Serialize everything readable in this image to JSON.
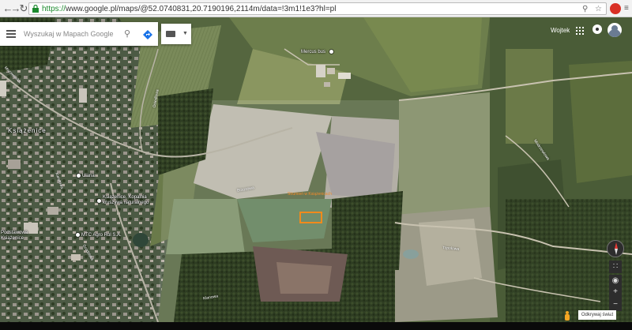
{
  "browser": {
    "url_secure": "https://",
    "url_rest": "www.google.pl/maps/@52.0740831,20.7190196,2114m/data=!3m1!1e3?hl=pl",
    "back_icon": "arrow-left-icon",
    "forward_icon": "arrow-right-icon",
    "reload_icon": "reload-icon"
  },
  "search": {
    "placeholder": "Wyszukaj w Mapach Google",
    "icon": "search-icon",
    "directions_icon": "directions-icon"
  },
  "account": {
    "user_name": "Wojtek"
  },
  "map": {
    "view": "satellite",
    "town_label": "Książenice",
    "places": [
      {
        "label": "Mercus bus"
      },
      {
        "label": "Uiana"
      },
      {
        "label": "Książenice, Kopalnia kruszywa naturalnego"
      },
      {
        "label": "MTC Agro Rol S.A."
      },
      {
        "label": "Podstawowa Książenice"
      }
    ],
    "road_labels": [
      "Mazowiecka",
      "Osiedlowa",
      "Kwiatowa",
      "Grodziska",
      "Klonowa",
      "Modrzewiowa",
      "Topolowa",
      "Brzozowa"
    ],
    "annotation": "Strumień w Książenicach",
    "annotation_color": "#f08a1c"
  },
  "controls": {
    "zoom_in": "+",
    "zoom_out": "−",
    "discover": "Odkrywaj świat"
  },
  "colors": {
    "accent_red": "#e53935",
    "annotation_orange": "#f08a1c"
  }
}
